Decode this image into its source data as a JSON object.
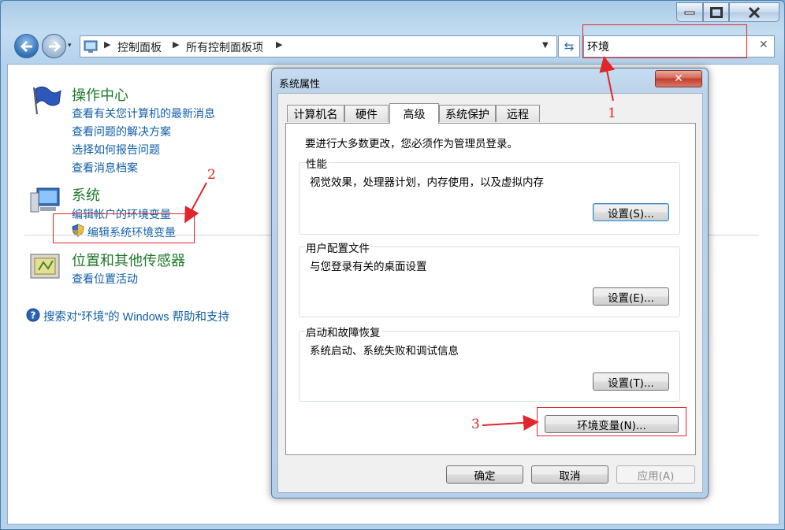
{
  "window": {
    "title_buttons": {
      "minimize_icon": "minimize-icon",
      "maximize_icon": "maximize-icon",
      "close_icon": "close-icon"
    }
  },
  "address_bar": {
    "crumbs": [
      "控制面板",
      "所有控制面板项"
    ]
  },
  "search": {
    "value": "环境",
    "clear": "✕"
  },
  "categories": [
    {
      "title": "操作中心",
      "links": [
        "查看有关您计算机的最新消息",
        "查看问题的解决方案",
        "选择如何报告问题",
        "查看消息档案"
      ]
    },
    {
      "title": "系统",
      "links": [
        "编辑帐户的环境变量",
        "编辑系统环境变量"
      ]
    },
    {
      "title": "位置和其他传感器",
      "links": [
        "查看位置活动"
      ]
    }
  ],
  "help_link": "搜索对“环境”的 Windows 帮助和支持",
  "annotations": [
    "1",
    "2",
    "3"
  ],
  "dialog": {
    "title": "系统属性",
    "close": "✕",
    "tabs": [
      "计算机名",
      "硬件",
      "高级",
      "系统保护",
      "远程"
    ],
    "active_tab": "高级",
    "admin_note": "要进行大多数更改，您必须作为管理员登录。",
    "groups": [
      {
        "label": "性能",
        "desc": "视觉效果，处理器计划，内存使用，以及虚拟内存",
        "button": "设置(S)..."
      },
      {
        "label": "用户配置文件",
        "desc": "与您登录有关的桌面设置",
        "button": "设置(E)..."
      },
      {
        "label": "启动和故障恢复",
        "desc": "系统启动、系统失败和调试信息",
        "button": "设置(T)..."
      }
    ],
    "env_button": "环境变量(N)...",
    "ok": "确定",
    "cancel": "取消",
    "apply": "应用(A)"
  },
  "colors": {
    "annotation_red": "#e0262a",
    "link_blue": "#0f5ea8",
    "category_green": "#1e7a2a"
  }
}
